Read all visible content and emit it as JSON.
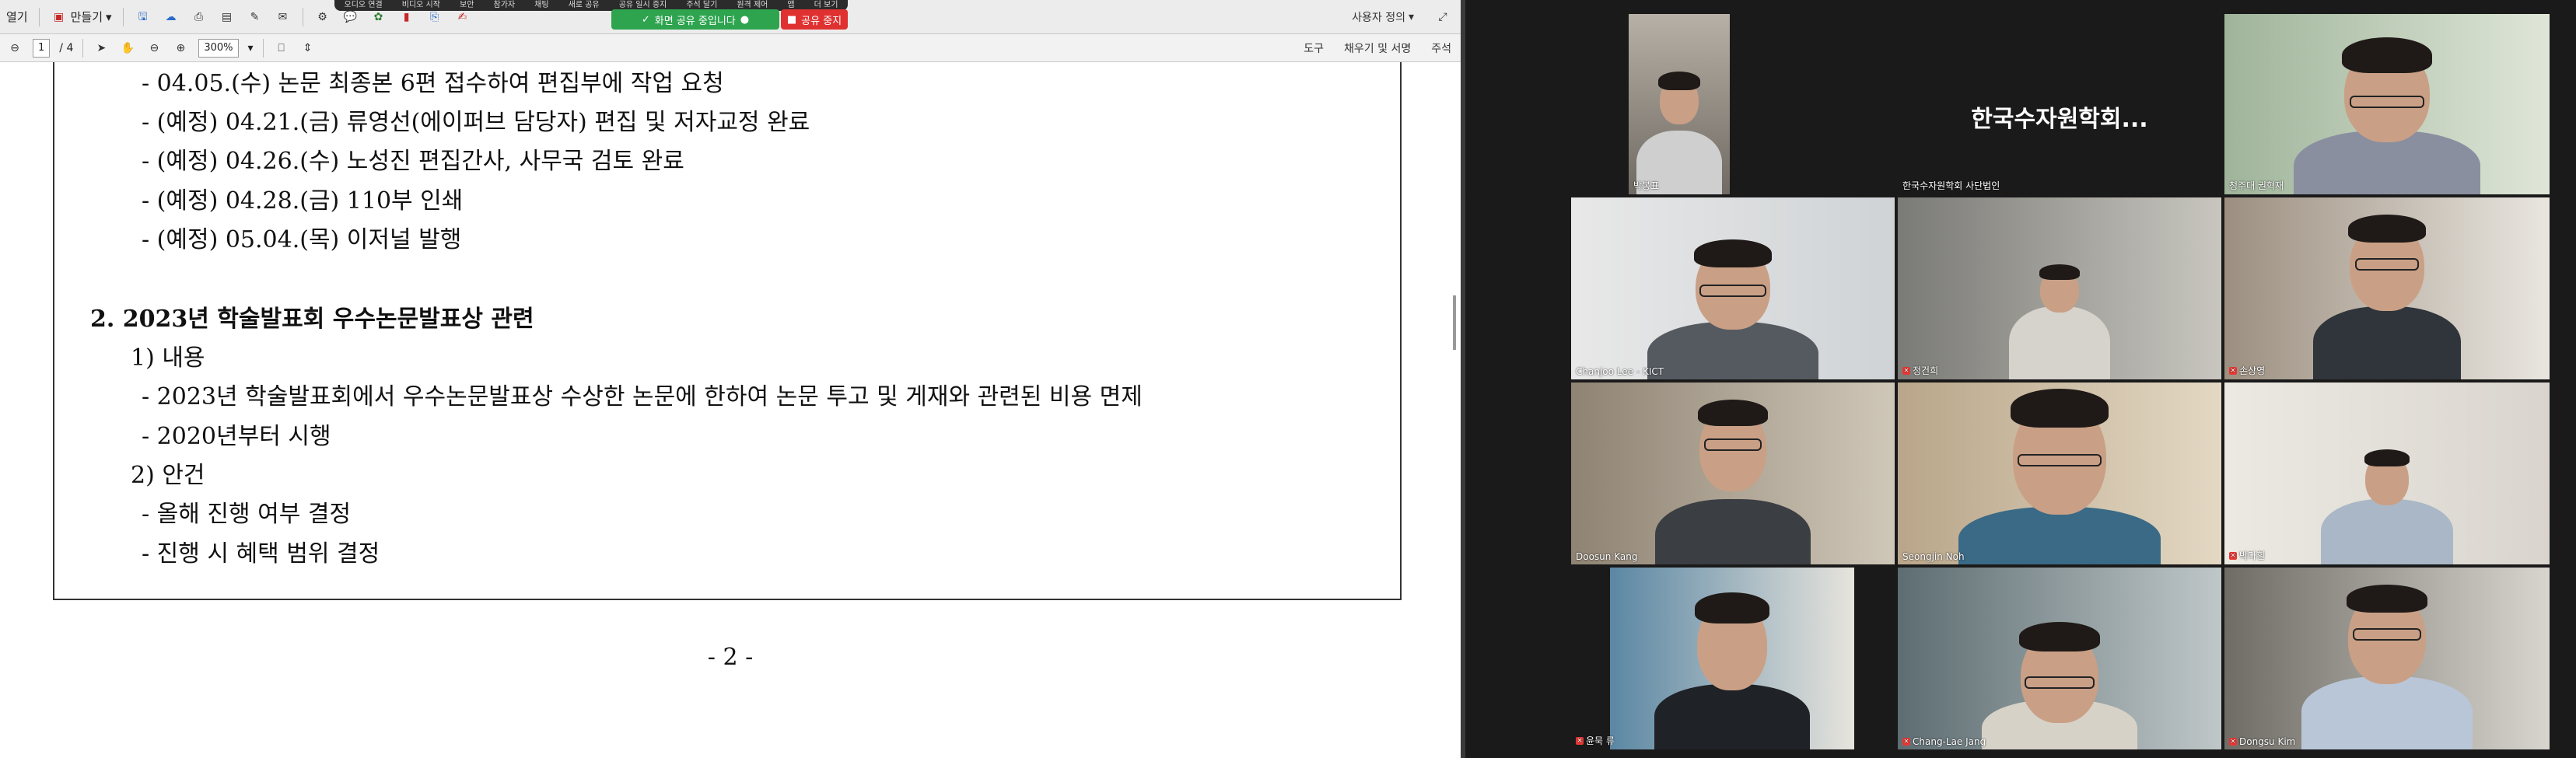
{
  "toolbar": {
    "open_label": "열기",
    "create_label": "만들기",
    "page_current": "1",
    "page_total": "/ 4",
    "zoom": "300%",
    "menu_user": "사용자 정의",
    "tools_label": "도구",
    "fill_sign_label": "채우기 및 서명",
    "comment_label": "주석"
  },
  "screen_share": {
    "menu_items": [
      "오디오 연결",
      "비디오 시작",
      "보안",
      "참가자",
      "채팅",
      "새로 공유",
      "공유 일시 중지",
      "주석 달기",
      "원격 제어",
      "앱",
      "더 보기"
    ],
    "sharing_status": "화면 공유 중입니다",
    "stop_label": "공유 중지"
  },
  "document": {
    "lines": [
      "- 04.05.(수) 논문 최종본 6편 접수하여 편집부에 작업 요청",
      "- (예정) 04.21.(금) 류영선(에이퍼브 담당자) 편집 및 저자교정 완료",
      "- (예정) 04.26.(수) 노성진 편집간사, 사무국 검토 완료",
      "- (예정) 04.28.(금) 110부 인쇄",
      "- (예정) 05.04.(목) 이저널 발행",
      "2. 2023년 학술발표회 우수논문발표상 관련",
      "1) 내용",
      "- 2023년 학술발표회에서 우수논문발표상 수상한 논문에 한하여 논문 투고 및 게재와 관련된 비용 면제",
      "- 2020년부터 시행",
      "2) 안건",
      "- 올해 진행 여부 결정",
      "- 진행 시 혜택 범위 결정"
    ],
    "page_number": "- 2 -"
  },
  "participants": [
    {
      "name": "박봉표"
    },
    {
      "name": "한국수자원학회 사단법인",
      "display": "한국수자원학회..."
    },
    {
      "name": "청주대 권혁재"
    },
    {
      "name": "Chanjoo Lee - KICT"
    },
    {
      "name": "정건희"
    },
    {
      "name": "손상영"
    },
    {
      "name": "Doosun Kang"
    },
    {
      "name": "Seongjin Noh"
    },
    {
      "name": "박다흰"
    },
    {
      "name": "윤묵 류"
    },
    {
      "name": "Chang-Lae Jang"
    },
    {
      "name": "Dongsu Kim"
    }
  ],
  "colors": {
    "share_green": "#2ea44f",
    "share_red": "#e03131",
    "active_speaker": "#f5d21e"
  }
}
